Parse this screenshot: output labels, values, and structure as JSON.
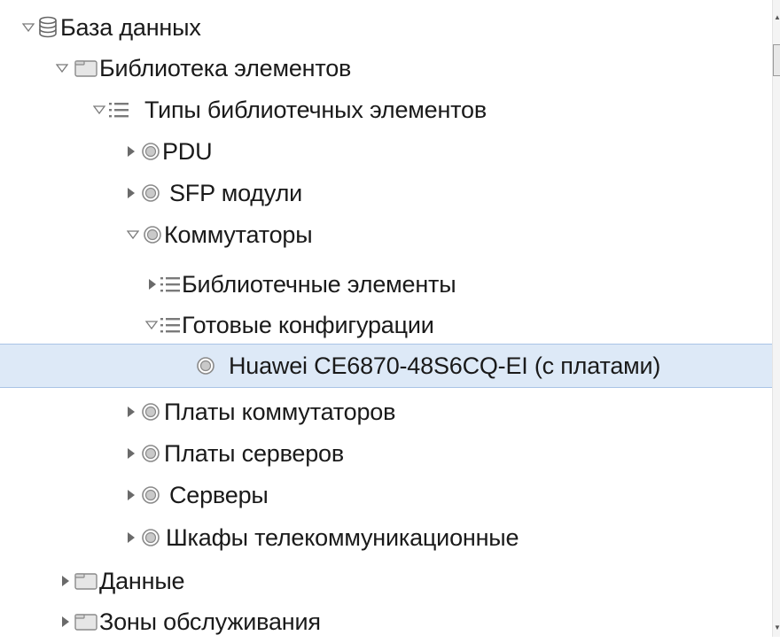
{
  "tree": {
    "nodes": [
      {
        "label": "База данных",
        "state": "expanded",
        "icon": "database-icon"
      },
      {
        "label": "Библиотека элементов",
        "state": "expanded",
        "icon": "folder-icon"
      },
      {
        "label": "Типы библиотечных элементов",
        "state": "expanded",
        "icon": "list-icon"
      },
      {
        "label": "PDU",
        "state": "collapsed",
        "icon": "circle-icon"
      },
      {
        "label": "SFP модули",
        "state": "collapsed",
        "icon": "circle-icon"
      },
      {
        "label": "Коммутаторы",
        "state": "expanded",
        "icon": "circle-icon"
      },
      {
        "label": "Библиотечные элементы",
        "state": "collapsed",
        "icon": "list-icon"
      },
      {
        "label": "Готовые конфигурации",
        "state": "expanded",
        "icon": "list-icon"
      },
      {
        "label": "Huawei CE6870-48S6CQ-EI (с платами)",
        "state": "leaf",
        "icon": "circle-icon",
        "selected": true
      },
      {
        "label": "Платы коммутаторов",
        "state": "collapsed",
        "icon": "circle-icon"
      },
      {
        "label": "Платы серверов",
        "state": "collapsed",
        "icon": "circle-icon"
      },
      {
        "label": "Серверы",
        "state": "collapsed",
        "icon": "circle-icon"
      },
      {
        "label": "Шкафы телекоммуникационные",
        "state": "collapsed",
        "icon": "circle-icon"
      },
      {
        "label": "Данные",
        "state": "collapsed",
        "icon": "folder-icon"
      },
      {
        "label": "Зоны обслуживания",
        "state": "collapsed",
        "icon": "folder-icon"
      }
    ]
  },
  "colors": {
    "selection_bg": "#dde9f7",
    "selection_border": "#a9c4e6",
    "text": "#1a1a1a",
    "icon_gray": "#8a8a8a"
  }
}
